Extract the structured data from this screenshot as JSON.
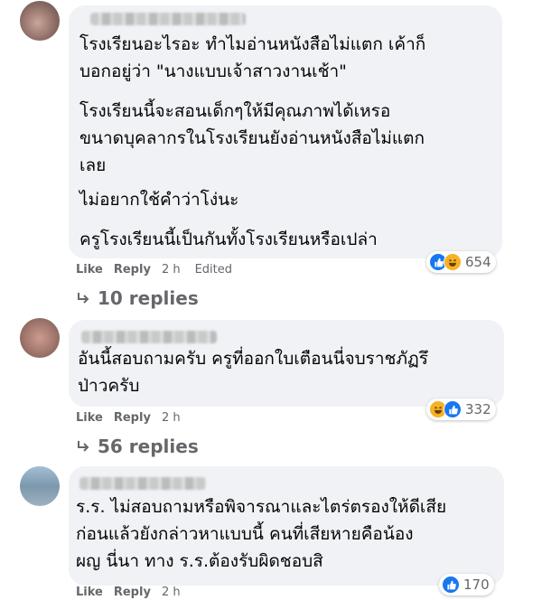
{
  "comments": [
    {
      "lines": [
        "โรงเรียนอะไรอะ ทำไมอ่านหนังสือไม่แตก เค้าก็",
        "บอกอยู่ว่า \"นางแบบเจ้าสาวงานเช้า\"",
        "โรงเรียนนี้จะสอนเด็กๆให้มีคุณภาพได้เหรอ",
        "ขนาดบุคลากรในโรงเรียนยังอ่านหนังสือไม่แตก",
        "เลย",
        "ไม่อยากใช้คำว่าโง่นะ",
        "ครูโรงเรียนนี้เป็นกันทั้งโรงเรียนหรือเปล่า"
      ],
      "like_label": "Like",
      "reply_label": "Reply",
      "time": "2 h",
      "edited": "Edited",
      "reaction_count": "654",
      "reactions": [
        "like-icon",
        "haha-icon"
      ],
      "replies": "10 replies"
    },
    {
      "lines": [
        "อันนี้สอบถามครับ ครูที่ออกใบเตือนนี่จบราชภัฏรึ",
        "ป่าวครับ"
      ],
      "like_label": "Like",
      "reply_label": "Reply",
      "time": "2 h",
      "reaction_count": "332",
      "reactions": [
        "haha-icon",
        "like-icon"
      ],
      "replies": "56 replies"
    },
    {
      "lines": [
        "ร.ร. ไม่สอบถามหรือพิจารณาและไตร่ตรองให้ดีเสีย",
        "ก่อนแล้วยังกล่าวหาแบบนี้ คนที่เสียหายคือน้อง",
        "ผญ นี่นา ทาง ร.ร.ต้องรับผิดชอบสิ"
      ],
      "like_label": "Like",
      "reply_label": "Reply",
      "time": "2 h",
      "reaction_count": "170",
      "reactions": [
        "like-icon"
      ]
    }
  ],
  "colors": {
    "bubble": "#f0f2f5",
    "meta": "#65676b",
    "like_blue": "#1877f2",
    "haha_yellow": "#f7b125"
  }
}
